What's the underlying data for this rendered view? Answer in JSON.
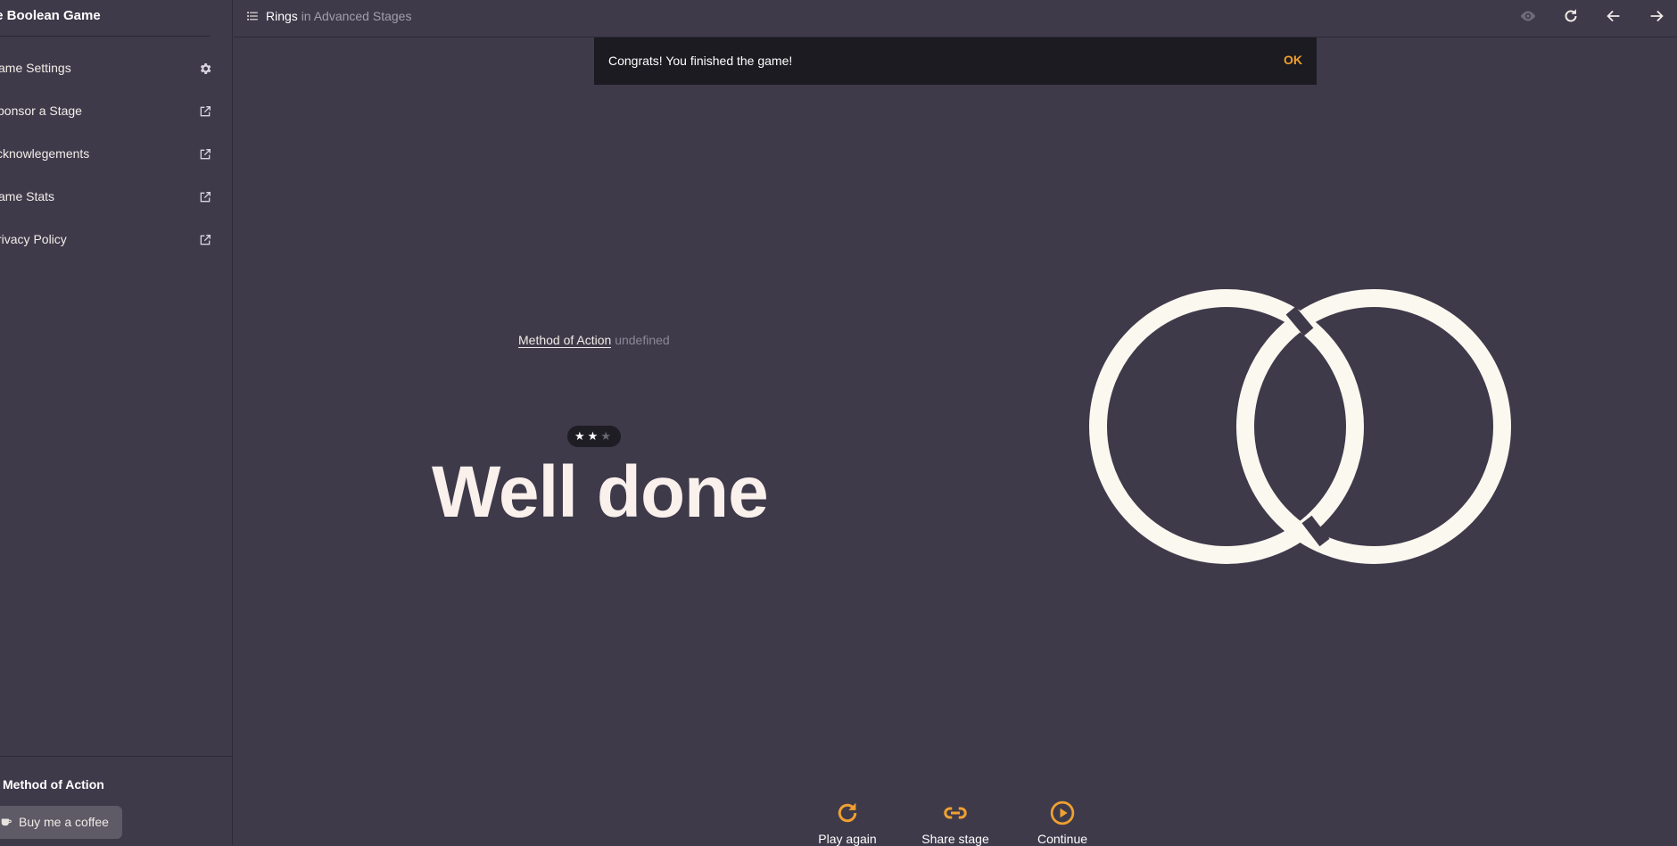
{
  "sidebar": {
    "title": "he Boolean Game",
    "items": [
      {
        "label": "ame Settings",
        "icon": "gear-icon"
      },
      {
        "label": "ponsor a Stage",
        "icon": "external-link-icon"
      },
      {
        "label": "cknowlegements",
        "icon": "external-link-icon"
      },
      {
        "label": "ame Stats",
        "icon": "external-link-icon"
      },
      {
        "label": "rivacy Policy",
        "icon": "external-link-icon"
      }
    ],
    "footer_title": "Method of Action",
    "coffee_label": "Buy me a coffee"
  },
  "topbar": {
    "stage": "Rings",
    "in_text": "in Advanced Stages"
  },
  "toast": {
    "message": "Congrats! You finished the game!",
    "ok": "OK"
  },
  "main": {
    "method_link": "Method of Action",
    "method_value": "undefined",
    "stars_earned": 2,
    "stars_total": 3,
    "headline": "Well done"
  },
  "actions": [
    {
      "label": "Play again",
      "icon": "replay-icon"
    },
    {
      "label": "Share stage",
      "icon": "link-icon"
    },
    {
      "label": "Continue",
      "icon": "play-circle-icon"
    }
  ],
  "colors": {
    "background": "#3e3a4a",
    "accent": "#f0a030",
    "toast_bg": "#1c1b21",
    "ring": "#fbf8f0"
  }
}
